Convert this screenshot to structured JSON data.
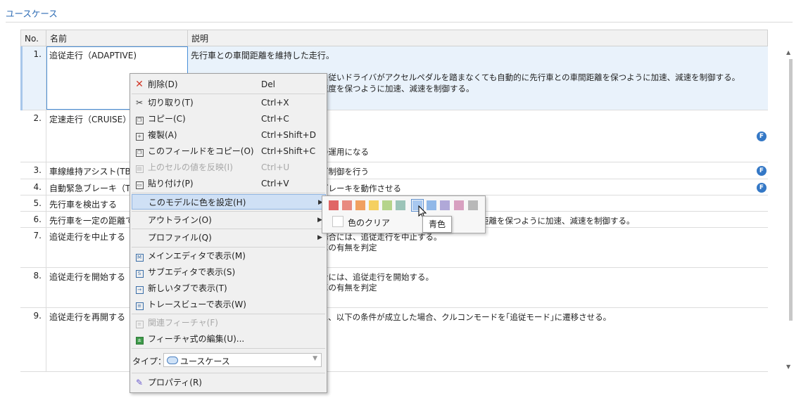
{
  "page": {
    "title": "ユースケース"
  },
  "table": {
    "headers": {
      "no": "No.",
      "name": "名前",
      "desc": "説明"
    },
    "rows": [
      {
        "no": "1.",
        "name": "追従走行（ADAPTIVE)",
        "desc": [
          "先行車との車間距離を維持した走行。",
          "に従いドライバがアクセルペダルを踏まなくても自動的に先行車との車間距離を保つように加速、減速を制御する。",
          "速度を保つように加速、減速を制御する。"
        ]
      },
      {
        "no": "2.",
        "name": "定速走行（CRUISE）",
        "desc": [
          "の運用になる"
        ]
      },
      {
        "no": "3.",
        "name": "車線維持アシスト(TBD",
        "desc": [
          "グ制御を行う"
        ]
      },
      {
        "no": "4.",
        "name": "自動緊急ブレーキ（TB",
        "desc": [
          "ブレーキを動作させる"
        ]
      },
      {
        "no": "5.",
        "name": "先行車を検出する",
        "desc": [
          ""
        ]
      },
      {
        "no": "6.",
        "name": "先行車を一定の距離で",
        "desc": [
          "距離を保つように加速、減速を制御する。"
        ]
      },
      {
        "no": "7.",
        "name": "追従走行を中止する",
        "desc": [
          "場合には、追従走行を中止する。",
          "車の有無を判定"
        ]
      },
      {
        "no": "8.",
        "name": "追従走行を開始する",
        "desc": [
          "合には、追従走行を開始する。",
          "車の有無を判定"
        ]
      },
      {
        "no": "9.",
        "name": "追従走行を再開する",
        "desc": [
          "に、以下の条件が成立した場合、クルコンモードを｢追従モード｣に遷移させる。"
        ]
      }
    ],
    "badge_label": "F"
  },
  "context_menu": {
    "items": [
      {
        "icon": "delete-icon",
        "label": "削除(D)",
        "shortcut": "Del"
      },
      {
        "icon": "cut-icon",
        "label": "切り取り(T)",
        "shortcut": "Ctrl+X"
      },
      {
        "icon": "copy-icon",
        "label": "コピー(C)",
        "shortcut": "Ctrl+C"
      },
      {
        "icon": "duplicate-icon",
        "label": "複製(A)",
        "shortcut": "Ctrl+Shift+D"
      },
      {
        "icon": "copy-field-icon",
        "label": "このフィールドをコピー(O)",
        "shortcut": "Ctrl+Shift+C"
      },
      {
        "icon": "reflect-icon",
        "label": "上のセルの値を反映(I)",
        "shortcut": "Ctrl+U"
      },
      {
        "icon": "paste-icon",
        "label": "貼り付け(P)",
        "shortcut": "Ctrl+V"
      },
      {
        "label": "このモデルに色を設定(H)"
      },
      {
        "label": "アウトライン(O)"
      },
      {
        "label": "プロファイル(Q)"
      },
      {
        "icon": "main-editor-icon",
        "label": "メインエディタで表示(M)"
      },
      {
        "icon": "sub-editor-icon",
        "label": "サブエディタで表示(S)"
      },
      {
        "icon": "new-tab-icon",
        "label": "新しいタブで表示(T)"
      },
      {
        "icon": "trace-view-icon",
        "label": "トレースビューで表示(W)"
      },
      {
        "icon": "related-feature-icon",
        "label": "関連フィーチャ(F)"
      },
      {
        "icon": "feature-formula-icon",
        "label": "フィーチャ式の編集(U)..."
      },
      {
        "icon": "properties-icon",
        "label": "プロパティ(R)"
      }
    ],
    "type_label": "タイプ：",
    "type_value": "ユースケース"
  },
  "color_menu": {
    "swatches": [
      "#e06666",
      "#e88a80",
      "#f0a060",
      "#f5d060",
      "#b5d48a",
      "#9cc4b8",
      "#a8c8f0",
      "#90b8e8",
      "#b0a8d8",
      "#d8a0c0",
      "#b8b8b8"
    ],
    "clear_label": "色のクリア",
    "tooltip": "青色"
  }
}
